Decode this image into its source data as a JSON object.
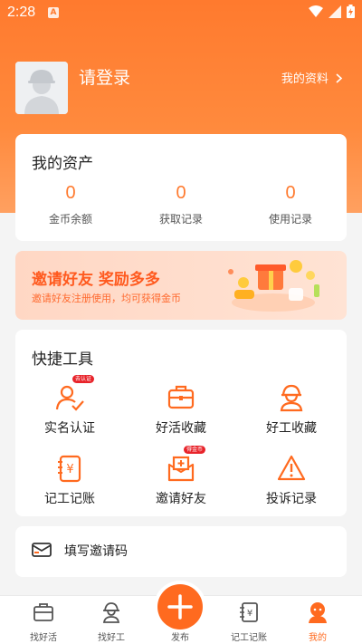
{
  "status_bar": {
    "time": "2:28",
    "app_badge": "A"
  },
  "profile": {
    "login_text": "请登录",
    "my_info_link": "我的资料"
  },
  "assets": {
    "title": "我的资产",
    "items": [
      {
        "value": "0",
        "label": "金币余额"
      },
      {
        "value": "0",
        "label": "获取记录"
      },
      {
        "value": "0",
        "label": "使用记录"
      }
    ]
  },
  "invite_banner": {
    "title": "邀请好友  奖励多多",
    "subtitle": "邀请好友注册使用，均可获得金币"
  },
  "tools": {
    "title": "快捷工具",
    "items": [
      {
        "label": "实名认证",
        "tag": "去认证"
      },
      {
        "label": "好活收藏"
      },
      {
        "label": "好工收藏"
      },
      {
        "label": "记工记账"
      },
      {
        "label": "邀请好友",
        "tag": "得金币"
      },
      {
        "label": "投诉记录"
      }
    ]
  },
  "invite_code": {
    "label": "填写邀请码"
  },
  "tabbar": {
    "items": [
      {
        "label": "找好活"
      },
      {
        "label": "找好工"
      },
      {
        "label": "发布"
      },
      {
        "label": "记工记账"
      },
      {
        "label": "我的"
      }
    ]
  },
  "colors": {
    "accent": "#ff6a1f",
    "tag_red": "#e8232a"
  }
}
